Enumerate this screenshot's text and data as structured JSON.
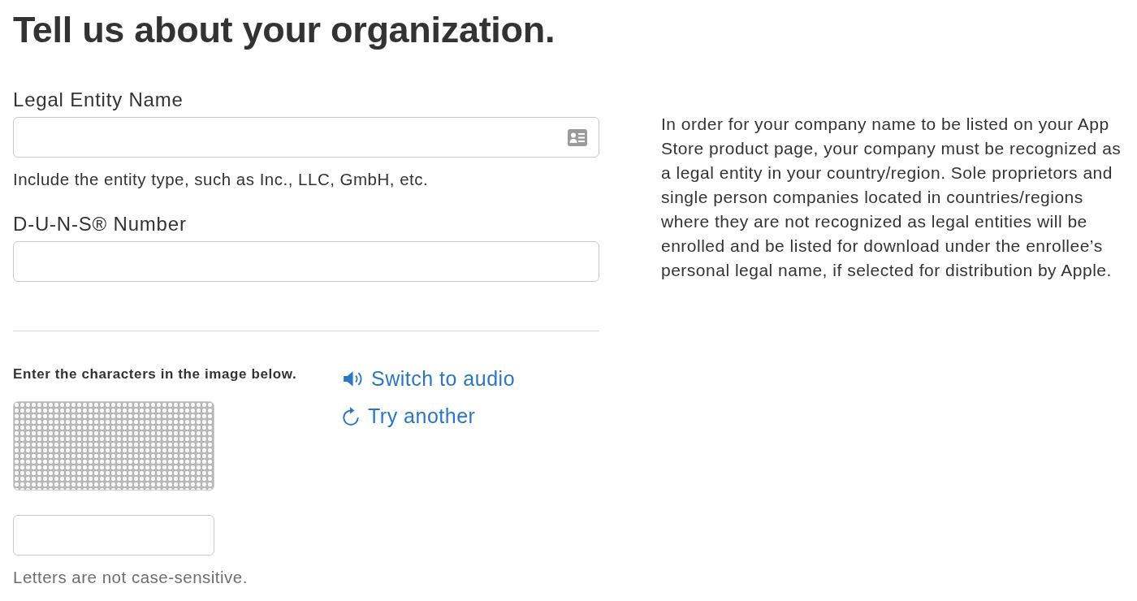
{
  "heading": "Tell us about your organization.",
  "fields": [
    {
      "label": "Legal Entity Name",
      "kind": "contact-card",
      "hint": "Include the entity type, such as Inc., LLC, GmbH, etc."
    },
    {
      "label": "D-U-N-S® Number",
      "kind": "plain"
    }
  ],
  "info_text": "In order for your company name to be listed on your App Store product page, your company must be recognized as a legal entity in your country/region. Sole proprietors and single person companies located in countries/regions where they are not recognized as legal entities will be enrolled and be listed for download under the enrollee’s personal legal name, if selected for distribution by Apple.",
  "captcha": {
    "instruction": "Enter the characters in the image below.",
    "links": [
      {
        "label": "Switch to audio",
        "kind": "audio"
      },
      {
        "label": "Try another",
        "kind": "refresh"
      }
    ],
    "hint": "Letters are not case-sensitive."
  }
}
